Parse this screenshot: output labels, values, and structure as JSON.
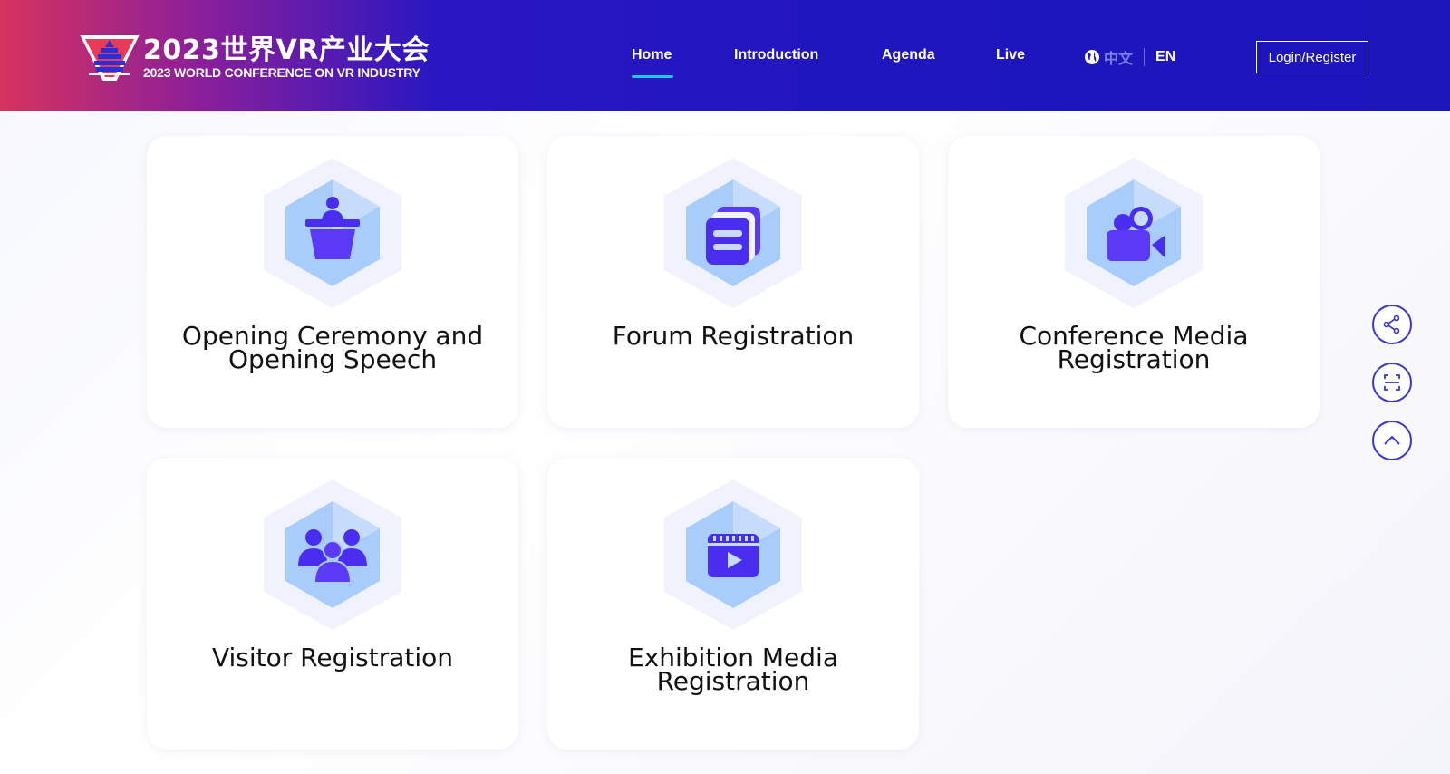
{
  "header": {
    "logo_cn": "2023世界VR产业大会",
    "logo_en": "2023 WORLD CONFERENCE ON VR INDUSTRY",
    "nav": [
      {
        "label": "Home",
        "active": true
      },
      {
        "label": "Introduction"
      },
      {
        "label": "Agenda"
      },
      {
        "label": "Live"
      }
    ],
    "lang_cn": "中文",
    "lang_en": "EN",
    "login_label": "Login/Register"
  },
  "cards": [
    {
      "label": "Opening Ceremony and Opening Speech",
      "icon": "podium-icon"
    },
    {
      "label": "Forum Registration",
      "icon": "forum-docs-icon"
    },
    {
      "label": "Conference Media Registration",
      "icon": "video-camera-icon"
    },
    {
      "label": "Visitor Registration",
      "icon": "group-people-icon"
    },
    {
      "label": "Exhibition Media Registration",
      "icon": "video-play-icon"
    }
  ],
  "side_buttons": [
    "share-icon",
    "scan-icon",
    "back-to-top-icon"
  ],
  "colors": {
    "header_blue": "#1f16be",
    "header_red": "#d6325e",
    "accent_underline": "#1ec8f5",
    "icon_purple": "#4a2ef0",
    "fab_border": "#3a34d0"
  }
}
